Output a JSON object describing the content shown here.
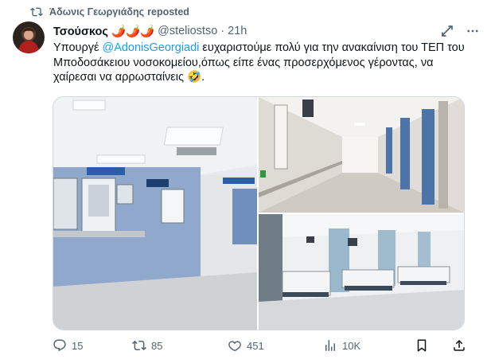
{
  "repost": {
    "name": "Άδωνις Γεωργιάδης",
    "suffix": "reposted"
  },
  "tweet": {
    "author_name": "Τσούσκος 🌶️🌶️🌶️",
    "handle": "@steliostso",
    "separator": "·",
    "time": "21h",
    "text_before": "Υπουργέ ",
    "mention": "@AdonisGeorgiadi",
    "text_after": " ευχαριστούμε πολύ για την ανακαίνιση του ΤΕΠ του Μποδοσάκειου νοσοκομείου,όπως είπε ένας προσερχόμενος γέροντας, να χαίρεσαι να αρρωσταίνεις 🤣."
  },
  "icons": {
    "repost": "repost-icon",
    "grok": "grok-icon",
    "more": "more-icon",
    "reply": "reply-icon",
    "retweet": "retweet-icon",
    "like": "heart-icon",
    "views": "views-icon",
    "bookmark": "bookmark-icon",
    "share": "share-icon"
  },
  "actions": {
    "replies": "15",
    "reposts": "85",
    "likes": "451",
    "views": "10K"
  },
  "colors": {
    "accent": "#1d9bf0",
    "muted": "#536471",
    "text": "#0f1419",
    "border": "#cfd9de"
  }
}
